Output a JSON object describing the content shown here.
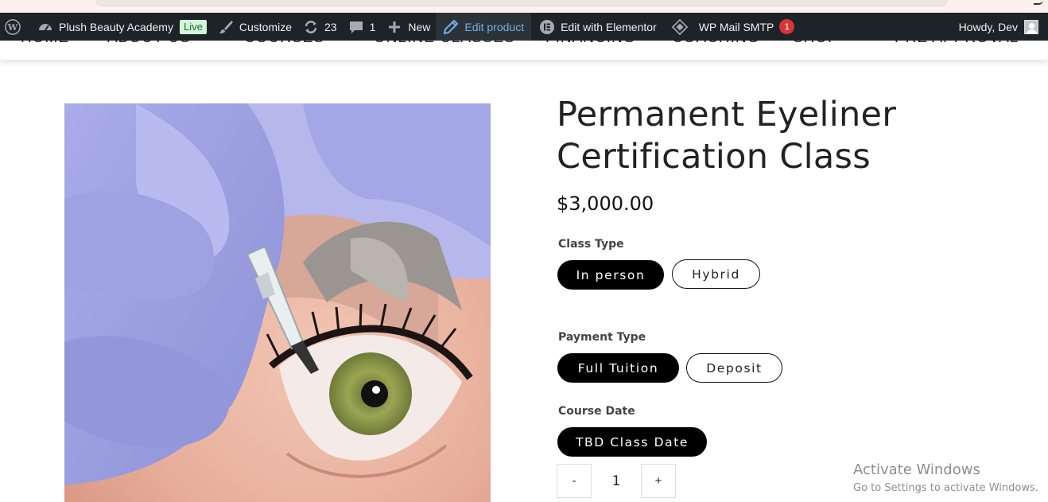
{
  "admin_bar": {
    "site_name": "Plush Beauty Academy",
    "live_badge": "Live",
    "customize": "Customize",
    "updates_count": "23",
    "comments_count": "1",
    "new_label": "New",
    "edit_product": "Edit product",
    "edit_elementor": "Edit with Elementor",
    "wp_mail_smtp": "WP Mail SMTP",
    "smtp_badge": "1",
    "howdy": "Howdy, Dev"
  },
  "nav": {
    "items": [
      "HOME",
      "ABOUT US",
      "COURSES",
      "ONLINE CLASSES",
      "FINANCING",
      "COACHING",
      "SHOP",
      "PRE APPROVAL"
    ]
  },
  "product": {
    "title_line1": "Permanent Eyeliner",
    "title_line2": "Certification Class",
    "price": "$3,000.00",
    "attributes": [
      {
        "label": "Class Type",
        "options": [
          "In person",
          "Hybrid"
        ],
        "selected": "In person"
      },
      {
        "label": "Payment Type",
        "options": [
          "Full Tuition",
          "Deposit"
        ],
        "selected": "Full Tuition"
      },
      {
        "label": "Course Date",
        "options": [
          "TBD Class Date"
        ],
        "selected": "TBD Class Date"
      }
    ],
    "quantity": {
      "minus": "-",
      "value": "1",
      "plus": "+"
    }
  },
  "watermark": {
    "title": "Activate Windows",
    "subtitle": "Go to Settings to activate Windows."
  },
  "colors": {
    "admin_bar_bg": "#1d2327",
    "active_link": "#72aee6",
    "live_badge_bg": "#d4f7dc",
    "count_badge": "#d63638",
    "swatch_selected": "#000000"
  },
  "icons": [
    "wordpress-icon",
    "dashboard-icon",
    "brush-icon",
    "updates-icon",
    "comment-icon",
    "plus-icon",
    "pencil-icon",
    "elementor-icon",
    "smtp-diamond-icon"
  ]
}
